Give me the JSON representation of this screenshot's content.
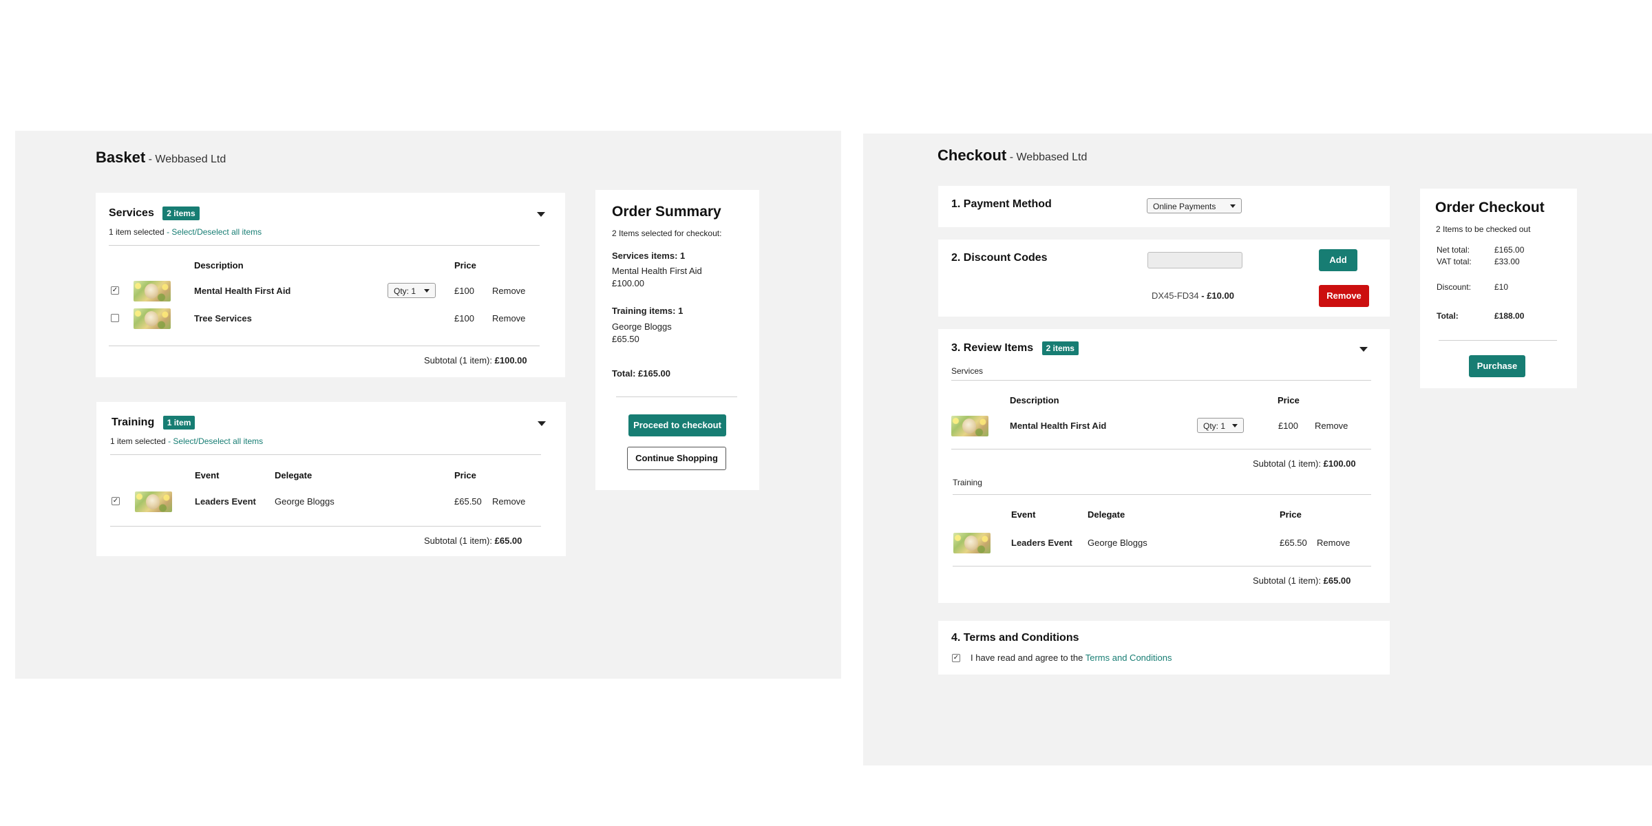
{
  "colors": {
    "accent": "#177d73",
    "danger": "#cc0f0f",
    "panel": "#f2f2f2"
  },
  "basket": {
    "title": "Basket",
    "subtitle": "- Webbased Ltd",
    "services": {
      "title": "Services",
      "badge": "2 items",
      "selected_text": "1 item selected",
      "select_link": "- Select/Deselect all items",
      "col_description": "Description",
      "col_price": "Price",
      "rows": [
        {
          "checked": "✓",
          "name": "Mental Health First Aid",
          "qty": "Qty: 1",
          "price": "£100",
          "remove": "Remove"
        },
        {
          "checked": "",
          "name": "Tree Services",
          "price": "£100",
          "remove": "Remove"
        }
      ],
      "subtotal_label": "Subtotal (1 item):",
      "subtotal_value": "£100.00"
    },
    "training": {
      "title": "Training",
      "badge": "1 item",
      "selected_text": "1 item selected",
      "select_link": "- Select/Deselect all items",
      "col_event": "Event",
      "col_delegate": "Delegate",
      "col_price": "Price",
      "rows": [
        {
          "checked": "✓",
          "name": "Leaders Event",
          "delegate": "George Bloggs",
          "price": "£65.50",
          "remove": "Remove"
        }
      ],
      "subtotal_label": "Subtotal (1 item):",
      "subtotal_value": "£65.00"
    },
    "summary": {
      "title": "Order Summary",
      "selected": "2 Items selected for checkout:",
      "services_label": "Services items: 1",
      "services_item": "Mental Health First Aid",
      "services_price": "£100.00",
      "training_label": "Training items: 1",
      "training_item": "George Bloggs",
      "training_price": "£65.50",
      "total": "Total: £165.00",
      "proceed": "Proceed to checkout",
      "continue": "Continue Shopping"
    }
  },
  "checkout": {
    "title": "Checkout",
    "subtitle": "- Webbased Ltd",
    "payment": {
      "title": "1. Payment Method",
      "select": "Online Payments"
    },
    "discount": {
      "title": "2. Discount Codes",
      "add": "Add",
      "code": "DX45-FD34",
      "code_value": "- £10.00",
      "remove": "Remove"
    },
    "review": {
      "title": "3. Review Items",
      "badge": "2 items",
      "services_label": "Services",
      "col_description": "Description",
      "col_price": "Price",
      "service_row": {
        "name": "Mental Health First Aid",
        "qty": "Qty: 1",
        "price": "£100",
        "remove": "Remove"
      },
      "services_subtotal_label": "Subtotal (1 item):",
      "services_subtotal_value": "£100.00",
      "training_label": "Training",
      "col_event": "Event",
      "col_delegate": "Delegate",
      "training_row": {
        "name": "Leaders Event",
        "delegate": "George Bloggs",
        "price": "£65.50",
        "remove": "Remove"
      },
      "training_subtotal_label": "Subtotal (1 item):",
      "training_subtotal_value": "£65.00"
    },
    "terms": {
      "title": "4. Terms and Conditions",
      "checked": "✓",
      "text": "I have read and agree to the",
      "link": "Terms and Conditions"
    },
    "order": {
      "title": "Order Checkout",
      "count": "2 Items to be checked out",
      "net_label": "Net total:",
      "net_value": "£165.00",
      "vat_label": "VAT total:",
      "vat_value": "£33.00",
      "discount_label": "Discount:",
      "discount_value": "£10",
      "total_label": "Total:",
      "total_value": "£188.00",
      "purchase": "Purchase"
    }
  }
}
